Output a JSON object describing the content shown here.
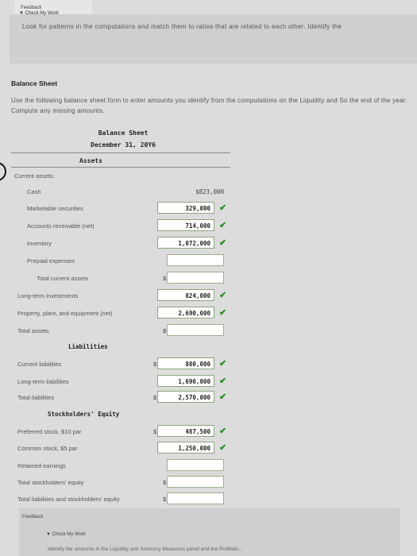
{
  "feedback_tab": "Feedback",
  "feedback": {
    "toggle": "▼ Check My Work",
    "text": "Look for patterns in the computations and match them to ratios that are related to each other. Identify the"
  },
  "section_title": "Balance Sheet",
  "instructions": "Use the following balance sheet form to enter amounts you identify from the computations on the Liquidity and So the end of the year. Compute any missing amounts.",
  "sheet": {
    "title": "Balance Sheet",
    "date": "December 31, 20Y6",
    "assets_heading": "Assets",
    "current_assets_label": "Current assets:",
    "rows": {
      "cash": {
        "label": "Cash",
        "value": "$823,000"
      },
      "marketable": {
        "label": "Marketable securities",
        "value": "329,000"
      },
      "receivable": {
        "label": "Accounts receivable (net)",
        "value": "714,000"
      },
      "inventory": {
        "label": "Inventory",
        "value": "1,072,000"
      },
      "prepaid": {
        "label": "Prepaid expenses",
        "value": ""
      },
      "total_current": {
        "label": "Total current assets",
        "value": ""
      },
      "long_term_inv": {
        "label": "Long-term investments",
        "value": "824,000"
      },
      "ppe": {
        "label": "Property, plant, and equipment (net)",
        "value": "2,690,000"
      },
      "total_assets": {
        "label": "Total assets",
        "value": ""
      },
      "liabilities_heading": {
        "label": "Liabilities"
      },
      "current_liab": {
        "label": "Current liabilities",
        "value": "880,000"
      },
      "long_term_liab": {
        "label": "Long-term liabilities",
        "value": "1,690,000"
      },
      "total_liab": {
        "label": "Total liabilities",
        "value": "2,570,000"
      },
      "equity_heading": {
        "label": "Stockholders' Equity"
      },
      "preferred": {
        "label": "Preferred stock, $10 par",
        "value": "487,500"
      },
      "common": {
        "label": "Common stock, $5 par",
        "value": "1,250,000"
      },
      "retained": {
        "label": "Retained earnings",
        "value": ""
      },
      "total_equity": {
        "label": "Total stockholders' equity",
        "value": ""
      },
      "total_liab_equity": {
        "label": "Total liabilities and stockholders' equity",
        "value": ""
      }
    },
    "dollar_sign": "$",
    "checkmark": "✔"
  },
  "bottom": {
    "tab": "Feedback",
    "toggle": "▼ Check My Work",
    "text": "Identify the amounts in the Liquidity and Solvency Measures panel and the Profitabi..."
  },
  "colors": {
    "check": "#2a8a2a",
    "field_border": "#8aa57d"
  }
}
